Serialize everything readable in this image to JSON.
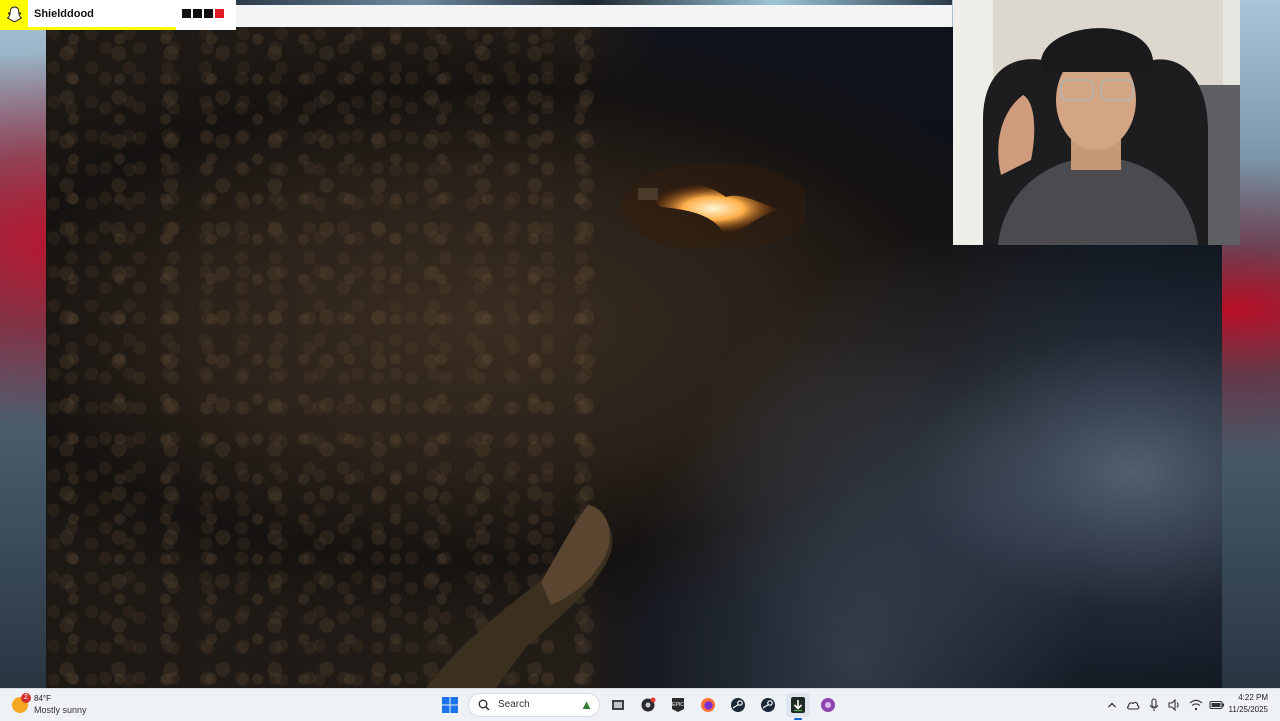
{
  "overlay": {
    "streamer_name": "Shielddood",
    "accent_color": "#fffc00",
    "squares": [
      "#111111",
      "#111111",
      "#111111",
      "#e01b24"
    ]
  },
  "taskbar": {
    "weather": {
      "badge": "2",
      "temperature": "84°F",
      "description": "Mostly sunny",
      "icon": "sun-icon"
    },
    "search_label": "Search",
    "apps": [
      "start-icon",
      "search-box",
      "file-explorer-icon",
      "epic-record-icon",
      "epic-games-icon",
      "firefox-icon",
      "steam-icon",
      "steam-icon-2",
      "terminal-download-icon",
      "app-icon-purple"
    ],
    "tray_icons": [
      "chevron-up-icon",
      "cloud-icon",
      "microphone-icon",
      "speaker-icon",
      "wifi-icon",
      "battery-icon"
    ],
    "clock": {
      "time": "4:22 PM",
      "date": "11/25/2025"
    }
  }
}
